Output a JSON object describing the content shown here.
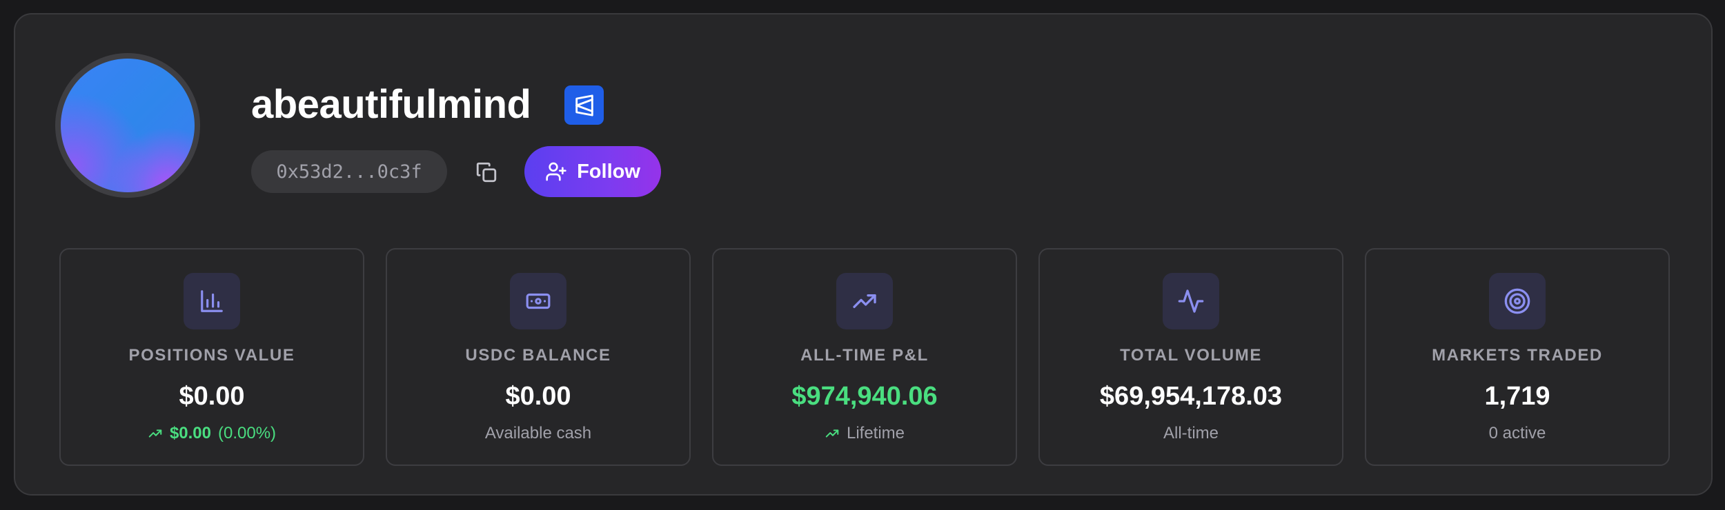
{
  "profile": {
    "username": "abeautifulmind",
    "address": "0x53d2...0c3f",
    "follow_label": "Follow"
  },
  "stats": [
    {
      "label": "POSITIONS VALUE",
      "value": "$0.00",
      "sub_amount": "$0.00",
      "sub_percent": "(0.00%)",
      "icon": "bar-chart-icon"
    },
    {
      "label": "USDC BALANCE",
      "value": "$0.00",
      "sub": "Available cash",
      "icon": "banknote-icon"
    },
    {
      "label": "ALL-TIME P&L",
      "value": "$974,940.06",
      "sub": "Lifetime",
      "icon": "trending-up-icon"
    },
    {
      "label": "TOTAL VOLUME",
      "value": "$69,954,178.03",
      "sub": "All-time",
      "icon": "activity-icon"
    },
    {
      "label": "MARKETS TRADED",
      "value": "1,719",
      "sub": "0 active",
      "icon": "target-icon"
    }
  ],
  "colors": {
    "positive": "#4ade80",
    "accent_icon": "#8b8ff0",
    "follow_gradient_start": "#5b3ff0",
    "follow_gradient_end": "#9533ea",
    "badge_blue": "#1f5ee8"
  }
}
